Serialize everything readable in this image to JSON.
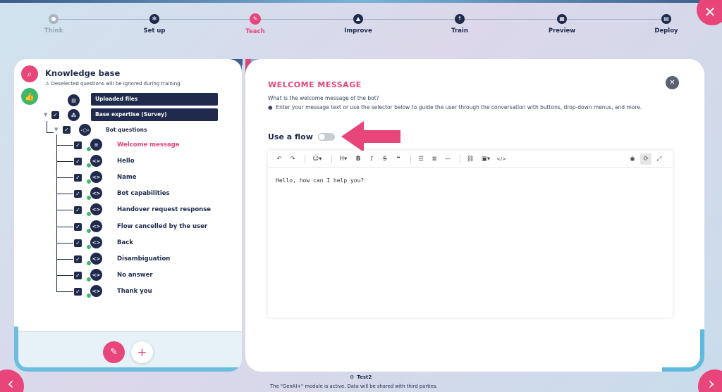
{
  "stepper": {
    "steps": [
      {
        "label": "Think",
        "icon": "lightbulb-icon",
        "state": "muted"
      },
      {
        "label": "Set up",
        "icon": "gear-icon",
        "state": "done"
      },
      {
        "label": "Teach",
        "icon": "pencil-icon",
        "state": "active"
      },
      {
        "label": "Improve",
        "icon": "flask-icon",
        "state": "done"
      },
      {
        "label": "Train",
        "icon": "upload-icon",
        "state": "done"
      },
      {
        "label": "Preview",
        "icon": "calendar-icon",
        "state": "done"
      },
      {
        "label": "Deploy",
        "icon": "layout-icon",
        "state": "done"
      }
    ]
  },
  "knowledge_base": {
    "title": "Knowledge base",
    "note": "Deselected questions will be ignored during training.",
    "uploaded_files": "Uploaded files",
    "base_expertise": "Base expertise (Survey)",
    "bot_questions": "Bot questions",
    "items": [
      {
        "label": "Welcome message",
        "selected": true
      },
      {
        "label": "Hello"
      },
      {
        "label": "Name"
      },
      {
        "label": "Bot capabilities"
      },
      {
        "label": "Handover request response"
      },
      {
        "label": "Flow cancelled by the user"
      },
      {
        "label": "Back"
      },
      {
        "label": "Disambiguation"
      },
      {
        "label": "No answer"
      },
      {
        "label": "Thank you"
      }
    ]
  },
  "editor_panel": {
    "title": "WELCOME MESSAGE",
    "question": "What is the welcome message of the bot?",
    "info": "Enter your message text or use the selector below to guide the user through the conversation with buttons, drop-down menus, and more.",
    "use_flow_label": "Use a flow",
    "toggle_on": false,
    "content": "Hello, how can I help you?"
  },
  "footer": {
    "bot_name": "Test2",
    "note": "The \"GenAI+\" module is active. Data will be shared with third parties."
  },
  "colors": {
    "accent": "#e8457a",
    "navy": "#1f2a4d",
    "green": "#3fb76a",
    "cyan": "#5fb8dd"
  }
}
